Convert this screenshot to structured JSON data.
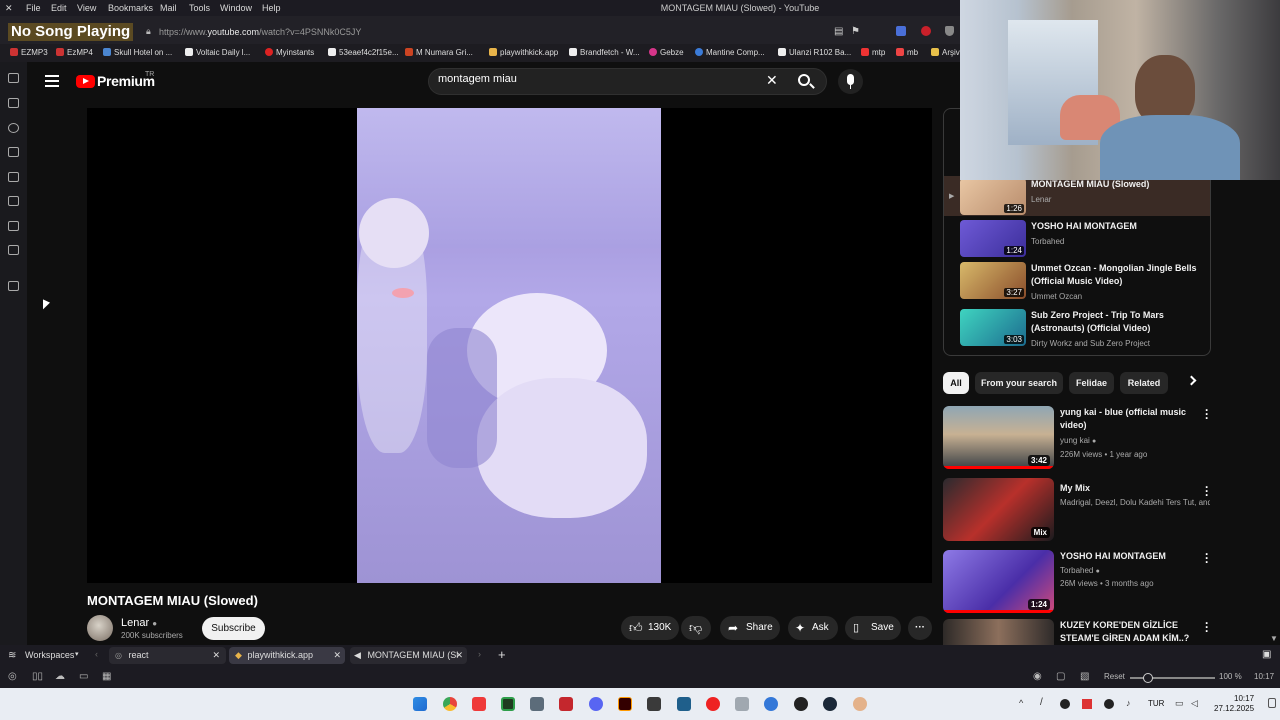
{
  "menubar": {
    "items": [
      "File",
      "Edit",
      "View",
      "Bookmarks",
      "Mail",
      "Tools",
      "Window",
      "Help"
    ],
    "window_title": "MONTAGEM MIAU (Slowed) - YouTube"
  },
  "overlay": {
    "now_playing": "No Song Playing"
  },
  "address": {
    "prefix": "https://www.",
    "domain": "youtube.com",
    "path": "/watch?v=4PSNNk0C5JY"
  },
  "bookmarks": [
    "EZMP3",
    "EzMP4",
    "Skull Hotel on ...",
    "Voltaic Daily l...",
    "Myinstants",
    "53eaef4c2f15e...",
    "M Numara Gri...",
    "playwithkick.app",
    "Brandfetch - W...",
    "Gebze",
    "Mantine Comp...",
    "Ulanzi R102 Ba...",
    "mtp",
    "mb",
    "Arşiv"
  ],
  "header": {
    "logo_text": "Premium",
    "region": "TR",
    "search_value": "montagem miau",
    "search_placeholder": "Search"
  },
  "video": {
    "title": "MONTAGEM MIAU (Slowed)",
    "channel": "Lenar",
    "subscribers": "200K subscribers",
    "subscribe_label": "Subscribe",
    "likes": "130K",
    "share_label": "Share",
    "ask_label": "Ask",
    "save_label": "Save"
  },
  "playlist": [
    {
      "title": "MONTAGEM MIAU (Slowed)",
      "channel": "Lenar",
      "duration": "1:26",
      "current": true
    },
    {
      "title": "YOSHO HAI MONTAGEM",
      "channel": "Torbahed",
      "duration": "1:24"
    },
    {
      "title": "Ummet Ozcan - Mongolian Jingle Bells (Official Music Video)",
      "channel": "Ummet Ozcan",
      "duration": "3:27"
    },
    {
      "title": "Sub Zero Project - Trip To Mars (Astronauts) (Official Video)",
      "channel": "Dirty Workz and Sub Zero Project",
      "duration": "3:03"
    }
  ],
  "chips": [
    "All",
    "From your search",
    "Felidae",
    "Related"
  ],
  "recommendations": [
    {
      "title": "yung kai - blue (official music video)",
      "channel": "yung kai",
      "meta": "226M views • 1 year ago",
      "duration": "3:42"
    },
    {
      "title": "My Mix",
      "channel": "Madrigal, Deezl, Dolu Kadehi Ters Tut, and more",
      "meta": "",
      "duration": "Mix"
    },
    {
      "title": "YOSHO HAI MONTAGEM",
      "channel": "Torbahed",
      "meta": "26M views • 3 months ago",
      "duration": "1:24"
    },
    {
      "title": "KUZEY KORE'DEN GİZLİCE STEAM'E GİREN ADAM KİM..?",
      "channel": "",
      "meta": "",
      "duration": ""
    }
  ],
  "browser_tabs": {
    "workspaces_label": "Workspaces",
    "tabs": [
      "react",
      "playwithkick.app",
      "MONTAGEM MIAU (Sl"
    ]
  },
  "status": {
    "reset_label": "Reset",
    "zoom": "100 %",
    "time_small": "10:17"
  },
  "taskbar": {
    "lang": "TUR",
    "time": "10:17",
    "date": "27.12.2025"
  },
  "colors": {
    "accent": "#ff0000",
    "background": "#0f0f0f"
  }
}
